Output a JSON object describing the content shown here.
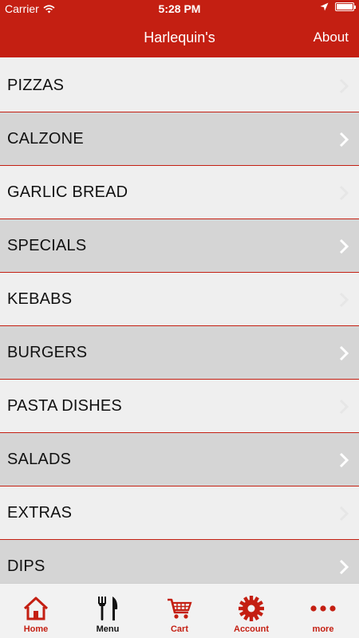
{
  "status_bar": {
    "carrier": "Carrier",
    "time": "5:28 PM"
  },
  "nav": {
    "title": "Harlequin's",
    "about_label": "About"
  },
  "menu": [
    {
      "label": "PIZZAS"
    },
    {
      "label": "CALZONE"
    },
    {
      "label": "GARLIC BREAD"
    },
    {
      "label": "SPECIALS"
    },
    {
      "label": "KEBABS"
    },
    {
      "label": "BURGERS"
    },
    {
      "label": "PASTA DISHES"
    },
    {
      "label": "SALADS"
    },
    {
      "label": "EXTRAS"
    },
    {
      "label": "DIPS"
    }
  ],
  "tabs": [
    {
      "label": "Home",
      "icon": "house-icon"
    },
    {
      "label": "Menu",
      "icon": "fork-knife-icon",
      "active": true
    },
    {
      "label": "Cart",
      "icon": "cart-icon"
    },
    {
      "label": "Account",
      "icon": "gear-icon"
    },
    {
      "label": "more",
      "icon": "more-dots-icon"
    }
  ],
  "colors": {
    "accent": "#c41f12",
    "row_light": "#efefef",
    "row_dark": "#d5d5d5",
    "tabbar_bg": "#f2f2f2"
  }
}
